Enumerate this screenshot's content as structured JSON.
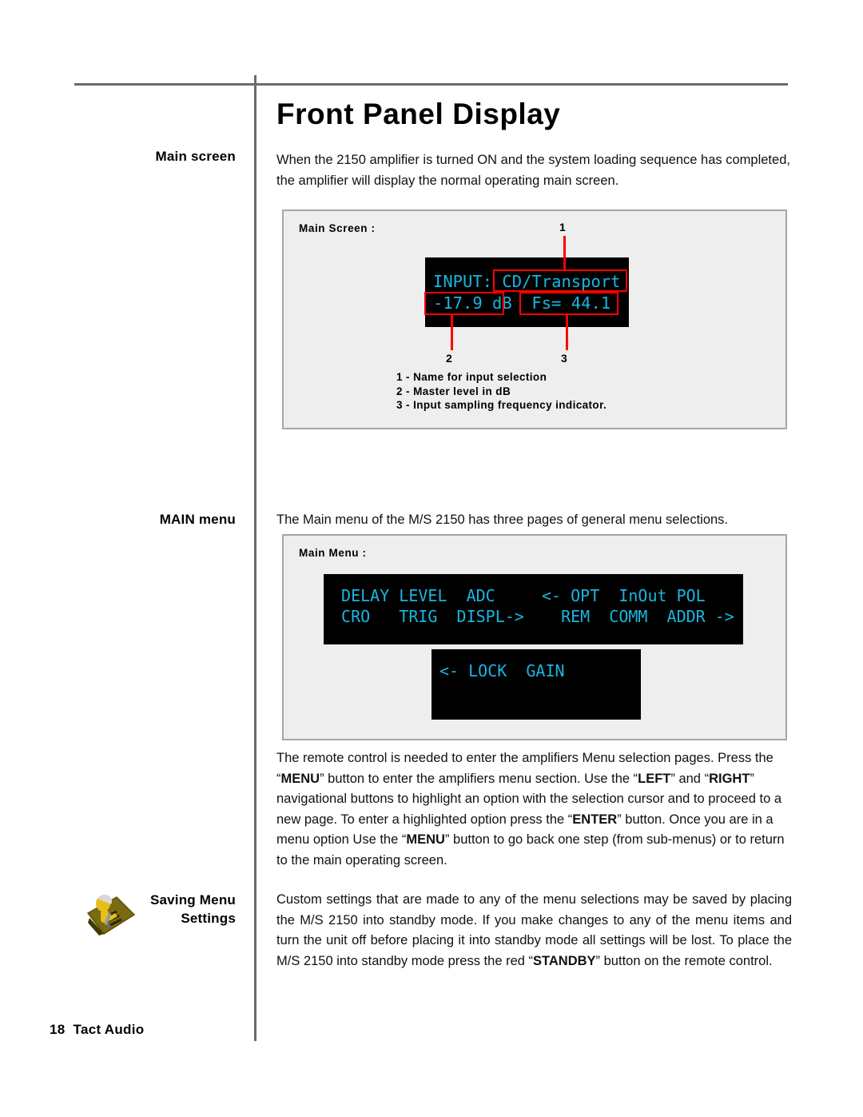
{
  "page": {
    "title": "Front Panel Display",
    "footer_page_number": "18",
    "footer_brand": "Tact Audio"
  },
  "margin_labels": {
    "main_screen": "Main screen",
    "main_menu": "MAIN menu",
    "saving_line1": "Saving Menu",
    "saving_line2": "Settings",
    "saving_icon_name": "hand-writing-note-icon"
  },
  "paragraphs": {
    "intro": "When the 2150 amplifier is turned ON and the system loading sequence has completed,  the amplifier will display the normal operating main screen.",
    "main_menu": "The Main menu of the M/S 2150 has three pages of general menu selections.",
    "remote_part1": "The remote control is needed to enter the amplifiers Menu selection pages. Press the “",
    "remote_b1": "MENU",
    "remote_part2": "” button to enter the amplifiers menu section. Use the “",
    "remote_b2": "LEFT",
    "remote_part3": "” and “",
    "remote_b3": "RIGHT",
    "remote_part4": "” navigational buttons to highlight an option with the selection cursor and to proceed to a new page. To enter a highlighted option press the “",
    "remote_b4": "ENTER",
    "remote_part5": "” button. Once you are in a menu option Use the “",
    "remote_b5": "MENU",
    "remote_part6": "” button to go back one step (from sub-menus) or to return to the main operating screen.",
    "saving_part1": "Custom settings that are made to any of the menu selections may be saved by placing the M/S 2150 into standby mode.  If you make changes to any of the menu items and turn the unit off before placing it into standby mode all settings will be lost. To place the M/S 2150 into standby mode press the red “",
    "saving_b1": "STANDBY",
    "saving_part2": "” button on the remote control."
  },
  "figure_main_screen": {
    "caption": "Main Screen :",
    "lcd": {
      "line1": "INPUT: CD/Transport",
      "line2": "-17.9 dB  Fs= 44.1",
      "text_color": "#19b6e0",
      "background": "#000000"
    },
    "callouts": [
      {
        "number": "1",
        "target": "CD/Transport"
      },
      {
        "number": "2",
        "target": "-17.9 dB"
      },
      {
        "number": "3",
        "target": "Fs= 44.1"
      }
    ],
    "callout_color": "#ff0000",
    "legend": [
      "1 - Name for input selection",
      "2 - Master level in dB",
      "3 - Input sampling frequency indicator."
    ]
  },
  "figure_main_menu": {
    "caption": "Main Menu :",
    "pages": [
      {
        "name": "menu-page-1",
        "line1": " DELAY LEVEL  ADC",
        "line2": " CRO   TRIG  DISPL->"
      },
      {
        "name": "menu-page-2",
        "line1": "<- OPT  InOut POL",
        "line2": "  REM  COMM  ADDR ->"
      },
      {
        "name": "menu-page-3",
        "line1": "<- LOCK  GAIN",
        "line2": ""
      }
    ],
    "text_color": "#19b6e0",
    "background": "#000000"
  }
}
